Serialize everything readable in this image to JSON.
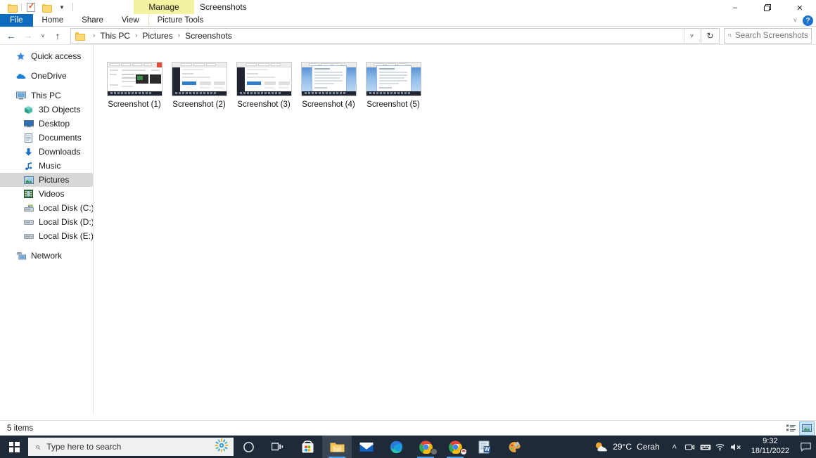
{
  "window": {
    "title": "Screenshots",
    "contextual_tab_header": "Manage",
    "quick_access": [
      {
        "name": "folder-icon",
        "label": "Folder"
      },
      {
        "name": "properties-icon",
        "label": "Properties"
      },
      {
        "name": "new-folder-icon",
        "label": "New folder"
      },
      {
        "name": "customize-caret-icon",
        "label": "Customize Quick Access Toolbar"
      }
    ],
    "controls": {
      "minimize": "–",
      "restore": "❐",
      "close": "✕",
      "collapse_ribbon": "˅",
      "help": "?"
    }
  },
  "ribbon": {
    "tabs": [
      {
        "label": "File",
        "active": true
      },
      {
        "label": "Home",
        "active": false
      },
      {
        "label": "Share",
        "active": false
      },
      {
        "label": "View",
        "active": false
      },
      {
        "label": "Picture Tools",
        "active": false,
        "contextual": true
      }
    ]
  },
  "address": {
    "back": "←",
    "forward": "→",
    "recent": "˅",
    "up": "↑",
    "breadcrumbs": [
      "This PC",
      "Pictures",
      "Screenshots"
    ],
    "separator": "›",
    "dropdown_caret": "˅",
    "refresh": "↻"
  },
  "search": {
    "placeholder": "Search Screenshots",
    "icon": "search-icon"
  },
  "sidebar": {
    "items": [
      {
        "label": "Quick access",
        "icon": "pin-icon",
        "level": 0,
        "selected": false
      },
      {
        "label": "OneDrive",
        "icon": "cloud-icon",
        "level": 0,
        "selected": false
      },
      {
        "label": "This PC",
        "icon": "monitor-icon",
        "level": 0,
        "selected": false
      },
      {
        "label": "3D Objects",
        "icon": "cube-icon",
        "level": 1,
        "selected": false
      },
      {
        "label": "Desktop",
        "icon": "desktop-icon",
        "level": 1,
        "selected": false
      },
      {
        "label": "Documents",
        "icon": "document-icon",
        "level": 1,
        "selected": false
      },
      {
        "label": "Downloads",
        "icon": "download-icon",
        "level": 1,
        "selected": false
      },
      {
        "label": "Music",
        "icon": "music-note-icon",
        "level": 1,
        "selected": false
      },
      {
        "label": "Pictures",
        "icon": "picture-icon",
        "level": 1,
        "selected": true
      },
      {
        "label": "Videos",
        "icon": "video-icon",
        "level": 1,
        "selected": false
      },
      {
        "label": "Local Disk (C:)",
        "icon": "system-drive-icon",
        "level": 1,
        "selected": false
      },
      {
        "label": "Local Disk (D:)",
        "icon": "drive-icon",
        "level": 1,
        "selected": false
      },
      {
        "label": "Local Disk (E:)",
        "icon": "drive-icon",
        "level": 1,
        "selected": false
      },
      {
        "label": "Network",
        "icon": "network-icon",
        "level": 0,
        "selected": false
      }
    ]
  },
  "files": {
    "items": [
      {
        "name": "Screenshot (1)",
        "style": "browser-light"
      },
      {
        "name": "Screenshot (2)",
        "style": "browser-dark"
      },
      {
        "name": "Screenshot (3)",
        "style": "browser-dark"
      },
      {
        "name": "Screenshot (4)",
        "style": "doc-blue"
      },
      {
        "name": "Screenshot (5)",
        "style": "doc-blue"
      }
    ]
  },
  "status": {
    "item_count": "5 items",
    "views": [
      {
        "name": "details-view-button",
        "active": false
      },
      {
        "name": "large-icons-view-button",
        "active": true
      }
    ]
  },
  "taskbar": {
    "start": "start-button",
    "search_placeholder": "Type here to search",
    "apps": [
      {
        "name": "cortana-icon",
        "running": false
      },
      {
        "name": "task-view-icon",
        "running": false
      },
      {
        "name": "microsoft-store-icon",
        "running": false
      },
      {
        "name": "file-explorer-icon",
        "running": true,
        "active": true
      },
      {
        "name": "mail-icon",
        "running": false
      },
      {
        "name": "microsoft-edge-icon",
        "running": false
      },
      {
        "name": "google-chrome-icon",
        "running": true
      },
      {
        "name": "google-chrome-icon",
        "running": true
      },
      {
        "name": "microsoft-word-icon",
        "running": false
      },
      {
        "name": "paint-icon",
        "running": false
      }
    ],
    "weather": {
      "temperature": "29°C",
      "condition": "Cerah"
    },
    "tray": {
      "show_hidden": "˄",
      "icons": [
        "camera-icon",
        "keyboard-icon",
        "wifi-icon",
        "volume-muted-icon"
      ]
    },
    "clock": {
      "time": "9:32",
      "date": "18/11/2022"
    },
    "notifications": "▭"
  },
  "colors": {
    "accent": "#0f6cbd",
    "contextual_tab": "#f2f2a0",
    "taskbar": "#1f2a38",
    "selection": "#d8d8d8",
    "close_hover": "#e81123"
  }
}
